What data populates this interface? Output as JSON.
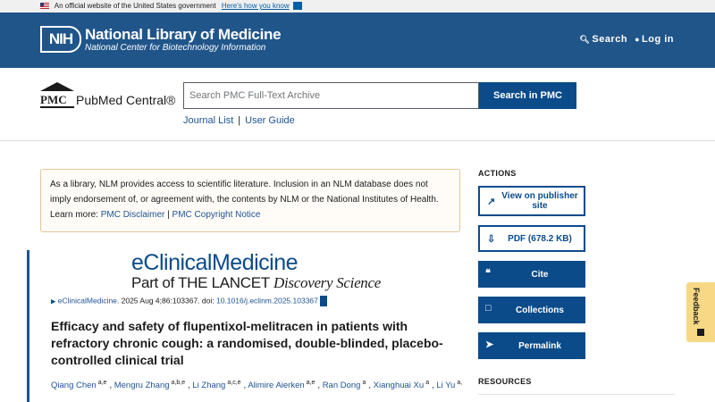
{
  "gov_banner": {
    "text": "An official website of the United States government",
    "link": "Here's how you know"
  },
  "header": {
    "logo": "NIH",
    "title": "National Library of Medicine",
    "subtitle": "National Center for Biotechnology Information",
    "search_label": "Search",
    "login_label": "Log in"
  },
  "pmc": {
    "logo_text": "PMC",
    "name": "PubMed Central®",
    "search_placeholder": "Search PMC Full-Text Archive",
    "search_button": "Search in PMC",
    "links": [
      "Journal List",
      "User Guide"
    ]
  },
  "notice": {
    "line1": "As a library, NLM provides access to scientific literature. Inclusion in an NLM database does not imply endorsement of, or agreement with, the contents by NLM or the National Institutes of Health.",
    "learn_more": "Learn more:",
    "link1": "PMC Disclaimer",
    "sep": "|",
    "link2": "PMC Copyright Notice"
  },
  "article": {
    "journal_name": "eClinicalMedicine",
    "journal_sub_prefix": "Part of THE LANCET",
    "journal_sub_italic": "Discovery Science",
    "citation_journal": "eClinicalMedicine",
    "citation_text": ". 2025 Aug 4;86:103367. doi: ",
    "doi": "10.1016/j.eclinm.2025.103367",
    "title": "Efficacy and safety of flupentixol-melitracen in patients with refractory chronic cough: a randomised, double-blinded, placebo-controlled clinical trial",
    "authors": [
      {
        "name": "Qiang Chen",
        "sup": "a,e"
      },
      {
        "name": "Mengru Zhang",
        "sup": "a,b,e"
      },
      {
        "name": "Li Zhang",
        "sup": "a,c,e"
      },
      {
        "name": "Alimire Aierken",
        "sup": "a,e"
      },
      {
        "name": "Ran Dong",
        "sup": "a"
      },
      {
        "name": "Xianghuai Xu",
        "sup": "a"
      },
      {
        "name": "Li Yu",
        "sup": "a,"
      }
    ]
  },
  "actions": {
    "heading": "ACTIONS",
    "buttons": [
      {
        "label": "View on publisher site",
        "icon": "external-link-icon"
      },
      {
        "label": "PDF (678.2 KB)",
        "icon": "download-icon"
      },
      {
        "label": "Cite",
        "icon": "quote-icon"
      },
      {
        "label": "Collections",
        "icon": "bookmark-icon"
      },
      {
        "label": "Permalink",
        "icon": "share-icon"
      }
    ]
  },
  "resources": {
    "heading": "RESOURCES"
  },
  "feedback": {
    "label": "Feedback"
  },
  "colors": {
    "header_bg": "#20558a",
    "primary": "#0b4b8a",
    "feedback_bg": "#f7d885",
    "notice_border": "#e2c69a"
  }
}
